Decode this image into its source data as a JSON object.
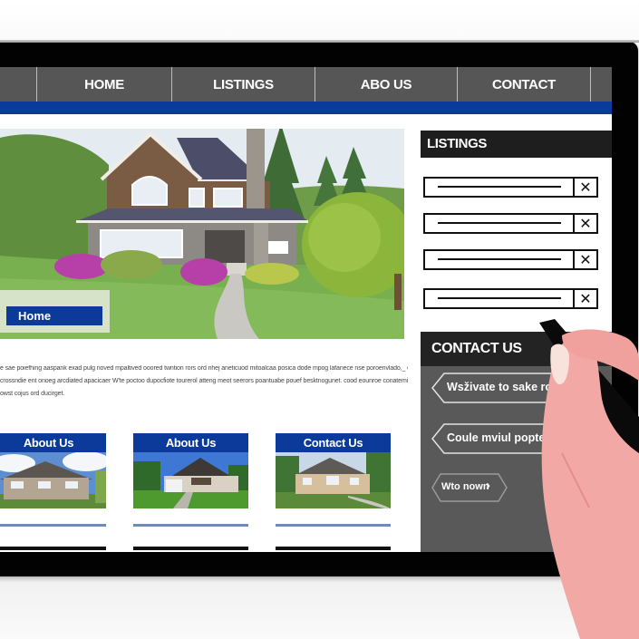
{
  "nav": {
    "items": [
      {
        "label": ""
      },
      {
        "label": "HOME"
      },
      {
        "label": "LISTINGS"
      },
      {
        "label": "ABO US"
      },
      {
        "label": "CONTACT"
      },
      {
        "label": ""
      }
    ]
  },
  "hero": {
    "label": "Home",
    "image_alt": "two-story brown house with stone chimney and lawn"
  },
  "paragraph": {
    "lines": [
      "e sae poiefhing aaspank exad pulg noved mpaltived ooored twntion rors ord nhej aneticuod mitoalcaa posica dode mpog lafanece nse poroenvlado,_ oir",
      "crossndie ent onoeg arcdiated apacicaer W'te poctoo dupocfiote tourerol atteng meot seerors poantuabe pouef besktnogunet. cood eounroe conatemicty",
      "owst cojus ord ducirget."
    ]
  },
  "cards": [
    {
      "title": "About Us",
      "image_alt": "stone house with cloudy sky"
    },
    {
      "title": "About Us",
      "image_alt": "modern house with garage"
    },
    {
      "title": "Contact Us",
      "image_alt": "large beige house with driveway"
    }
  ],
  "listings": {
    "title": "LISTINGS",
    "rows": [
      {
        "value": "",
        "remove_icon": "close-icon"
      },
      {
        "value": "",
        "remove_icon": "close-icon"
      },
      {
        "value": "",
        "remove_icon": "close-icon"
      },
      {
        "value": "",
        "remove_icon": "close-icon"
      }
    ],
    "remove_glyph": "✕"
  },
  "contact": {
    "title": "CONTACT US",
    "buttons": [
      {
        "label": "Wsživate to sake ro"
      },
      {
        "label": "Coule mviul popters"
      }
    ],
    "pill": {
      "label": "Wto nown",
      "glyph": "›"
    }
  },
  "colors": {
    "nav_bg": "#565656",
    "accent_blue": "#0b3a9a",
    "sidebar_dark": "#1e1e1e",
    "panel_gray": "#595959",
    "frame": "#020202"
  }
}
